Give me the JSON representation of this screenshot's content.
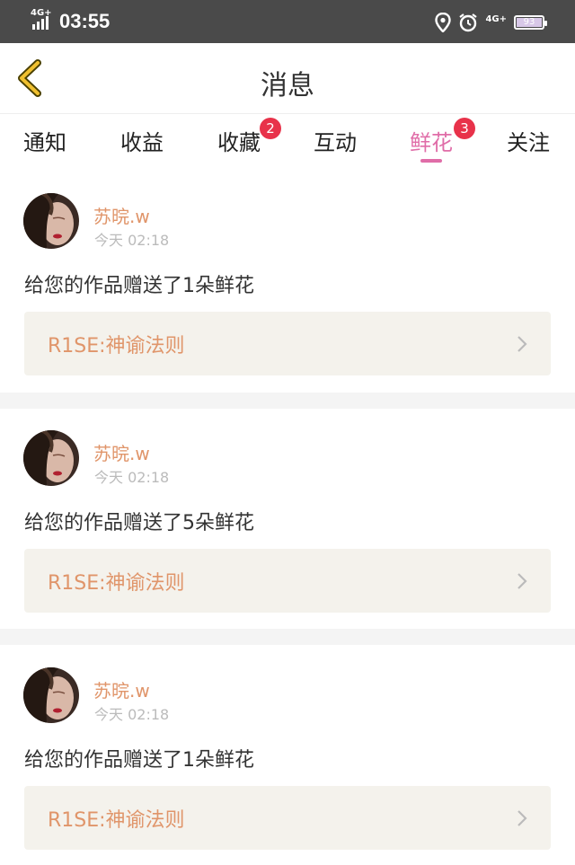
{
  "status": {
    "network": "4G+",
    "time": "03:55",
    "network_right": "4G+",
    "battery": "93"
  },
  "header": {
    "title": "消息"
  },
  "tabs": [
    {
      "label": "通知"
    },
    {
      "label": "收益"
    },
    {
      "label": "收藏",
      "badge": "2"
    },
    {
      "label": "互动"
    },
    {
      "label": "鲜花",
      "badge": "3",
      "active": true
    },
    {
      "label": "关注"
    }
  ],
  "messages": [
    {
      "user": "苏晥.w",
      "time": "今天 02:18",
      "text": "给您的作品赠送了1朵鲜花",
      "work": "R1SE:神谕法则"
    },
    {
      "user": "苏晥.w",
      "time": "今天 02:18",
      "text": "给您的作品赠送了5朵鲜花",
      "work": "R1SE:神谕法则"
    },
    {
      "user": "苏晥.w",
      "time": "今天 02:18",
      "text": "给您的作品赠送了1朵鲜花",
      "work": "R1SE:神谕法则"
    }
  ],
  "colors": {
    "accent": "#e06da8",
    "badge": "#e8324a",
    "username": "#e0956a",
    "back_arrow": "#f0c030"
  }
}
